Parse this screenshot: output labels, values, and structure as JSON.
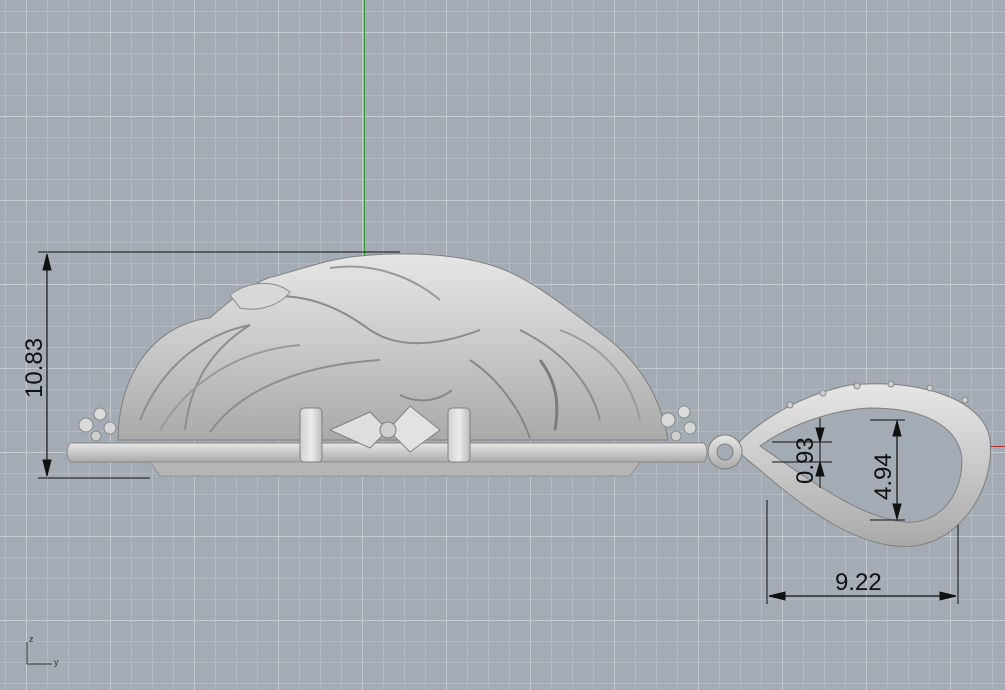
{
  "viewport": {
    "background": "#a3abb4",
    "grid_minor": "#b6bcc4",
    "grid_major": "#c8cdd4",
    "y_axis_color": "#2e9a3c",
    "x_axis_color": "#b03030"
  },
  "dimensions": {
    "total_height": "10.83",
    "bail_gap": "0.93",
    "bail_inner_height": "4.94",
    "bail_width": "9.22"
  },
  "axis_widget": {
    "z_label": "z",
    "y_label": "y"
  }
}
